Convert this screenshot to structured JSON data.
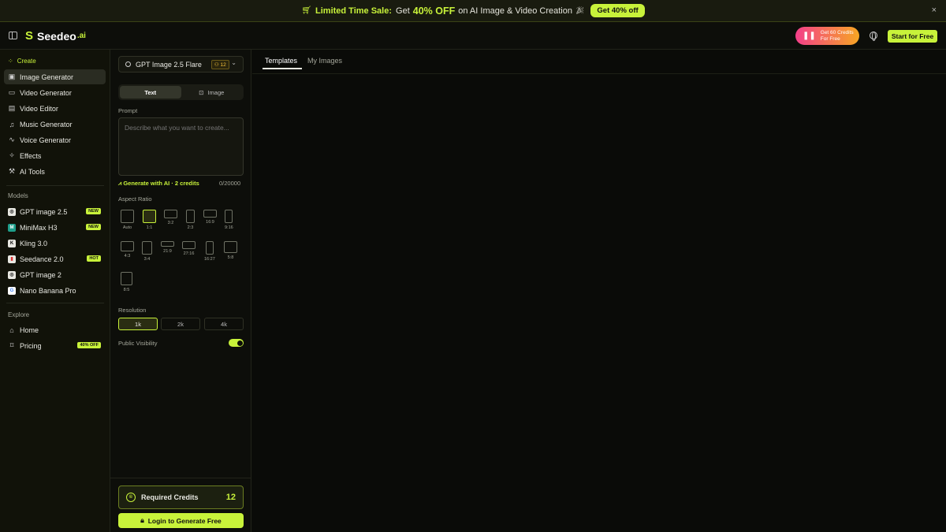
{
  "banner": {
    "tag": "Limited Time Sale:",
    "get": "Get",
    "pct": "40% OFF",
    "rest": "on AI Image & Video Creation",
    "cta": "Get 40% off",
    "close": "×"
  },
  "header": {
    "logo_name": "Seedeo",
    "logo_suffix": ".ai",
    "credits_line1": "Get 60 Credits",
    "credits_line2": "For Free",
    "start": "Start for Free"
  },
  "sidebar": {
    "create_head": "Create",
    "create_items": [
      {
        "label": "Image Generator",
        "icon": "image-icon"
      },
      {
        "label": "Video Generator",
        "icon": "video-icon"
      },
      {
        "label": "Video Editor",
        "icon": "film-icon"
      },
      {
        "label": "Music Generator",
        "icon": "music-icon"
      },
      {
        "label": "Voice Generator",
        "icon": "wave-icon"
      },
      {
        "label": "Effects",
        "icon": "sparkle-icon"
      },
      {
        "label": "AI Tools",
        "icon": "tools-icon"
      }
    ],
    "models_head": "Models",
    "models": [
      {
        "label": "GPT image 2.5",
        "badge": "NEW"
      },
      {
        "label": "MiniMax H3",
        "badge": "NEW"
      },
      {
        "label": "Kling 3.0",
        "badge": ""
      },
      {
        "label": "Seedance 2.0",
        "badge": "HOT"
      },
      {
        "label": "GPT image 2",
        "badge": ""
      },
      {
        "label": "Nano Banana Pro",
        "badge": ""
      }
    ],
    "explore_head": "Explore",
    "explore": [
      {
        "label": "Home",
        "badge": ""
      },
      {
        "label": "Pricing",
        "badge": "40% OFF"
      }
    ]
  },
  "panel": {
    "model_name": "GPT Image 2.5 Flare",
    "model_credits": "12",
    "mode_text": "Text",
    "mode_image": "Image",
    "prompt_label": "Prompt",
    "prompt_placeholder": "Describe what you want to create...",
    "gen_ai": "Generate with AI · 2 credits",
    "counter": "0/20000",
    "aspect_label": "Aspect Ratio",
    "ratios": [
      "Auto",
      "1:1",
      "3:2",
      "2:3",
      "16:9",
      "9:16",
      "4:3",
      "3:4",
      "21:9",
      "27:16",
      "16:27",
      "5:8",
      "8:5"
    ],
    "resolution_label": "Resolution",
    "resolutions": [
      "1k",
      "2k",
      "4k"
    ],
    "visibility_label": "Public Visibility",
    "required_label": "Required Credits",
    "required_value": "12",
    "login": "Login to Generate Free"
  },
  "main": {
    "tab_templates": "Templates",
    "tab_my_images": "My Images"
  }
}
